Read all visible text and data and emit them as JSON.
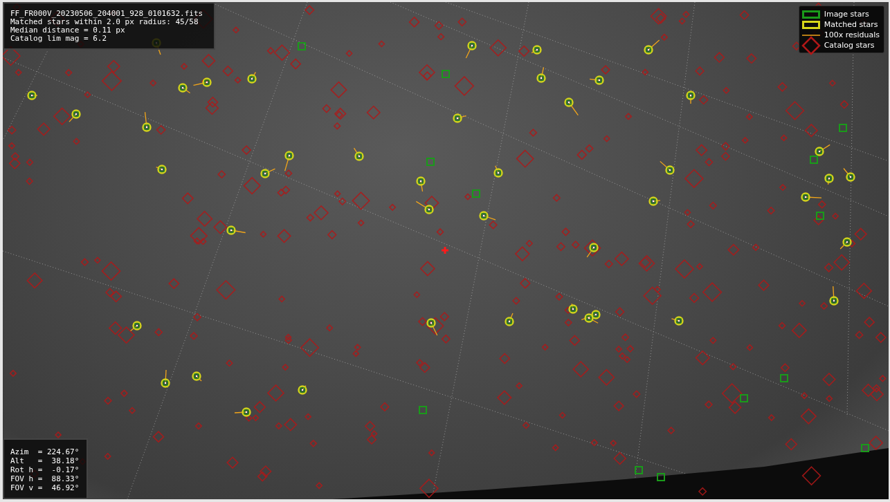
{
  "info_panel": {
    "lines": [
      "FF_FR000V_20230506_204001_928_0101632.fits",
      "Matched stars within 2.0 px radius: 45/58",
      "Median distance = 0.11 px",
      "Catalog lim mag = 6.2"
    ]
  },
  "legend": {
    "items": [
      {
        "kind": "image",
        "label": "Image stars"
      },
      {
        "kind": "matched",
        "label": "Matched stars"
      },
      {
        "kind": "residual",
        "label": "100x residuals"
      },
      {
        "kind": "catalog",
        "label": "Catalog stars"
      }
    ]
  },
  "pointing_panel": {
    "lines": [
      "Azim  = 224.67°",
      "Alt   =  38.18°",
      "Rot h =  -0.17°",
      "FOV h =  88.33°",
      "FOV v =  46.92°"
    ]
  }
}
